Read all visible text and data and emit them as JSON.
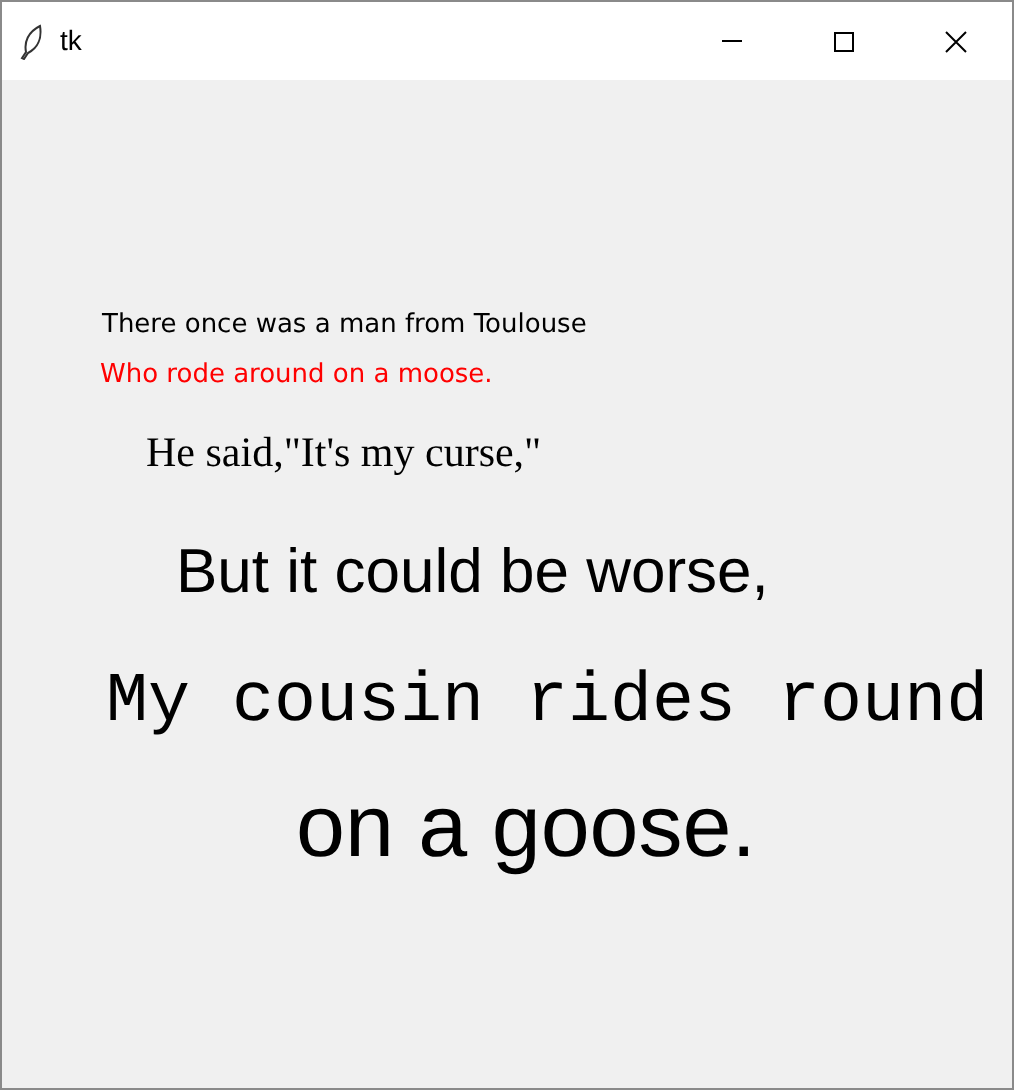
{
  "window": {
    "title": "tk"
  },
  "lines": [
    {
      "text": "There once was a man from Toulouse",
      "kind": "small",
      "color": "#000000"
    },
    {
      "text": "Who rode around on a moose.",
      "kind": "small",
      "color": "#ff0000"
    },
    {
      "text": "He said,\"It's my curse,\"",
      "kind": "serif",
      "color": "#000000"
    },
    {
      "text": "But it could be worse,",
      "kind": "sans",
      "color": "#000000"
    },
    {
      "text": "My cousin rides round",
      "kind": "mono",
      "color": "#000000"
    },
    {
      "text": "on a goose.",
      "kind": "big",
      "color": "#000000"
    }
  ]
}
